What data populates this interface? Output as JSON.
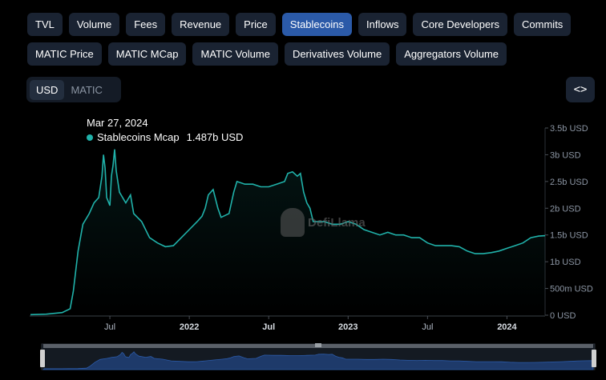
{
  "tabs_row1": [
    {
      "label": "TVL",
      "active": false
    },
    {
      "label": "Volume",
      "active": false
    },
    {
      "label": "Fees",
      "active": false
    },
    {
      "label": "Revenue",
      "active": false
    },
    {
      "label": "Price",
      "active": false
    },
    {
      "label": "Stablecoins",
      "active": true
    },
    {
      "label": "Inflows",
      "active": false
    },
    {
      "label": "Core Developers",
      "active": false
    },
    {
      "label": "Commits",
      "active": false
    }
  ],
  "tabs_row2": [
    {
      "label": "MATIC Price",
      "active": false
    },
    {
      "label": "MATIC MCap",
      "active": false
    },
    {
      "label": "MATIC Volume",
      "active": false
    },
    {
      "label": "Derivatives Volume",
      "active": false
    },
    {
      "label": "Aggregators Volume",
      "active": false
    }
  ],
  "currency": {
    "options": [
      "USD",
      "MATIC"
    ],
    "selected": "USD"
  },
  "embed_icon": "code-brackets-icon",
  "tooltip": {
    "date": "Mar 27, 2024",
    "series": "Stablecoins Mcap",
    "value": "1.487b USD"
  },
  "watermark": "DefiLlama",
  "colors": {
    "line": "#20b2aa",
    "accent": "#2b5aa8",
    "background": "#000000"
  },
  "chart_data": {
    "type": "line",
    "ylim": [
      0,
      3.5
    ],
    "yticks": [
      {
        "v": 0,
        "label": "0 USD"
      },
      {
        "v": 0.5,
        "label": "500m USD"
      },
      {
        "v": 1,
        "label": "1b USD"
      },
      {
        "v": 1.5,
        "label": "1.5b USD"
      },
      {
        "v": 2,
        "label": "2b USD"
      },
      {
        "v": 2.5,
        "label": "2.5b USD"
      },
      {
        "v": 3,
        "label": "3b USD"
      },
      {
        "v": 3.5,
        "label": "3.5b USD"
      }
    ],
    "xticks": [
      {
        "t": 2021.5,
        "label": "Jul",
        "year": false
      },
      {
        "t": 2022.0,
        "label": "2022",
        "year": true
      },
      {
        "t": 2022.5,
        "label": "Jul",
        "year": true
      },
      {
        "t": 2023.0,
        "label": "2023",
        "year": true
      },
      {
        "t": 2023.5,
        "label": "Jul",
        "year": false
      },
      {
        "t": 2024.0,
        "label": "2024",
        "year": true
      }
    ],
    "xlim": [
      2020.995,
      2024.24
    ],
    "grid": false,
    "series": [
      {
        "name": "Stablecoins Mcap",
        "points": [
          [
            2021.0,
            0.01
          ],
          [
            2021.1,
            0.02
          ],
          [
            2021.2,
            0.05
          ],
          [
            2021.25,
            0.12
          ],
          [
            2021.27,
            0.45
          ],
          [
            2021.3,
            1.2
          ],
          [
            2021.33,
            1.7
          ],
          [
            2021.37,
            1.9
          ],
          [
            2021.4,
            2.1
          ],
          [
            2021.43,
            2.2
          ],
          [
            2021.45,
            2.6
          ],
          [
            2021.46,
            3.0
          ],
          [
            2021.47,
            2.75
          ],
          [
            2021.48,
            2.2
          ],
          [
            2021.5,
            2.05
          ],
          [
            2021.51,
            2.6
          ],
          [
            2021.52,
            2.8
          ],
          [
            2021.53,
            3.1
          ],
          [
            2021.54,
            2.7
          ],
          [
            2021.56,
            2.3
          ],
          [
            2021.6,
            2.1
          ],
          [
            2021.63,
            2.25
          ],
          [
            2021.65,
            1.9
          ],
          [
            2021.7,
            1.75
          ],
          [
            2021.75,
            1.45
          ],
          [
            2021.8,
            1.35
          ],
          [
            2021.85,
            1.28
          ],
          [
            2021.9,
            1.3
          ],
          [
            2021.95,
            1.45
          ],
          [
            2022.0,
            1.6
          ],
          [
            2022.05,
            1.75
          ],
          [
            2022.08,
            1.85
          ],
          [
            2022.1,
            2.0
          ],
          [
            2022.12,
            2.25
          ],
          [
            2022.15,
            2.35
          ],
          [
            2022.18,
            2.0
          ],
          [
            2022.2,
            1.83
          ],
          [
            2022.25,
            1.9
          ],
          [
            2022.28,
            2.3
          ],
          [
            2022.3,
            2.5
          ],
          [
            2022.35,
            2.45
          ],
          [
            2022.4,
            2.45
          ],
          [
            2022.45,
            2.4
          ],
          [
            2022.5,
            2.4
          ],
          [
            2022.55,
            2.45
          ],
          [
            2022.6,
            2.5
          ],
          [
            2022.62,
            2.65
          ],
          [
            2022.65,
            2.68
          ],
          [
            2022.68,
            2.6
          ],
          [
            2022.7,
            2.65
          ],
          [
            2022.72,
            2.3
          ],
          [
            2022.74,
            2.1
          ],
          [
            2022.76,
            2.0
          ],
          [
            2022.78,
            1.75
          ],
          [
            2022.85,
            1.75
          ],
          [
            2022.9,
            1.7
          ],
          [
            2022.95,
            1.7
          ],
          [
            2023.0,
            1.75
          ],
          [
            2023.05,
            1.7
          ],
          [
            2023.1,
            1.6
          ],
          [
            2023.15,
            1.55
          ],
          [
            2023.2,
            1.5
          ],
          [
            2023.25,
            1.55
          ],
          [
            2023.3,
            1.5
          ],
          [
            2023.35,
            1.5
          ],
          [
            2023.4,
            1.45
          ],
          [
            2023.45,
            1.45
          ],
          [
            2023.5,
            1.35
          ],
          [
            2023.55,
            1.3
          ],
          [
            2023.6,
            1.3
          ],
          [
            2023.65,
            1.3
          ],
          [
            2023.7,
            1.28
          ],
          [
            2023.75,
            1.2
          ],
          [
            2023.8,
            1.15
          ],
          [
            2023.85,
            1.15
          ],
          [
            2023.9,
            1.17
          ],
          [
            2023.95,
            1.2
          ],
          [
            2024.0,
            1.25
          ],
          [
            2024.05,
            1.3
          ],
          [
            2024.1,
            1.35
          ],
          [
            2024.15,
            1.45
          ],
          [
            2024.2,
            1.48
          ],
          [
            2024.24,
            1.487
          ]
        ]
      }
    ]
  }
}
